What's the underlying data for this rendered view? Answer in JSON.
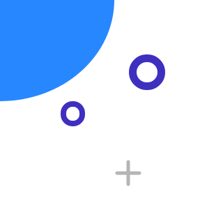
{
  "canvas": {
    "background": "#ffffff"
  },
  "shapes": {
    "quarter_disc": {
      "icon": "quarter-circle-shape",
      "color": "#2787FF"
    },
    "large_ring": {
      "icon": "ring-shape",
      "color": "#3F2FBF"
    },
    "small_ring": {
      "icon": "ring-shape",
      "color": "#3F2FBF"
    },
    "plus": {
      "icon": "plus-icon",
      "color": "#B5B5B5"
    }
  }
}
